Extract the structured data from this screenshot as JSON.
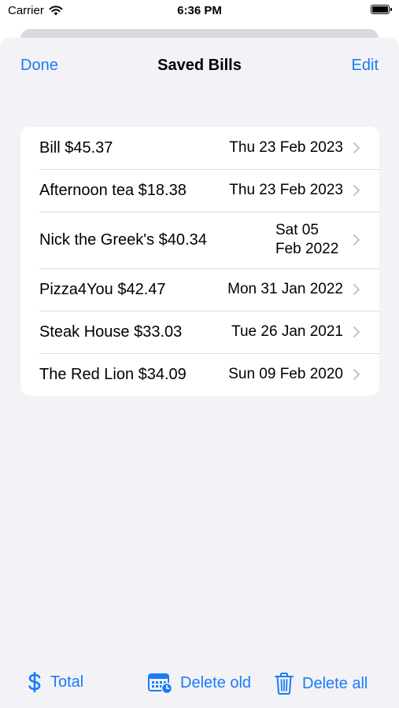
{
  "status_bar": {
    "carrier": "Carrier",
    "time": "6:36 PM",
    "icons": [
      "wifi-icon",
      "battery-icon"
    ]
  },
  "nav": {
    "left_button": "Done",
    "title": "Saved Bills",
    "right_button": "Edit"
  },
  "bills": [
    {
      "name": "Bill  $45.37",
      "date": "Thu 23 Feb 2023"
    },
    {
      "name": "Afternoon tea  $18.38",
      "date": "Thu 23 Feb 2023"
    },
    {
      "name": "Nick the Greek's  $40.34",
      "date": "Sat 05 Feb 2022"
    },
    {
      "name": "Pizza4You  $42.47",
      "date": "Mon 31 Jan 2022"
    },
    {
      "name": "Steak House  $33.03",
      "date": "Tue 26 Jan 2021"
    },
    {
      "name": "The Red Lion  $34.09",
      "date": "Sun 09 Feb 2020"
    }
  ],
  "toolbar": {
    "total": {
      "label": "Total",
      "icon": "dollar-sign-icon"
    },
    "delete_old": {
      "label": "Delete old",
      "icon": "calendar-clock-icon"
    },
    "delete_all": {
      "label": "Delete all",
      "icon": "trash-icon"
    }
  },
  "colors": {
    "accent": "#1a7cf5",
    "sheet_background": "#f2f2f7",
    "row_background": "#ffffff"
  }
}
